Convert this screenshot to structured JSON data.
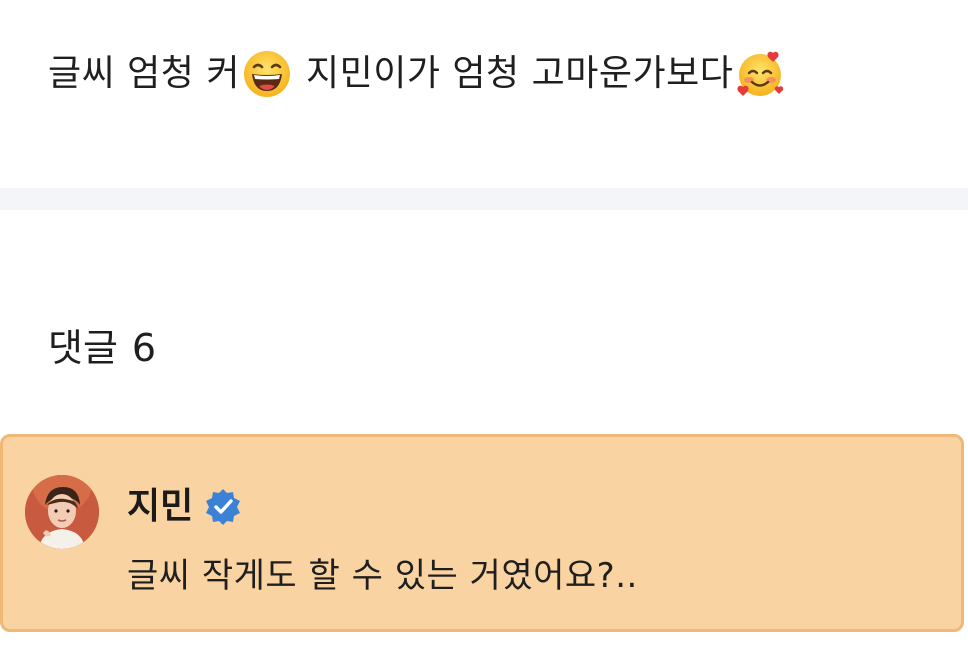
{
  "post": {
    "text_part1": "글씨 엄청 커",
    "emoji1": "grinning-squinting-face-icon",
    "text_part2": "지민이가 엄청 고마운가보다",
    "emoji2": "smiling-face-with-hearts-icon"
  },
  "comments": {
    "label": "댓글",
    "count": "6"
  },
  "highlighted_comment": {
    "author": "지민",
    "verified": true,
    "text": "글씨 작게도 할 수 있는 거였어요?.."
  },
  "colors": {
    "comment_background": "#f9d3a1",
    "comment_border": "#f0b877",
    "verified_badge": "#3b82d6",
    "divider": "#f4f5f8"
  }
}
